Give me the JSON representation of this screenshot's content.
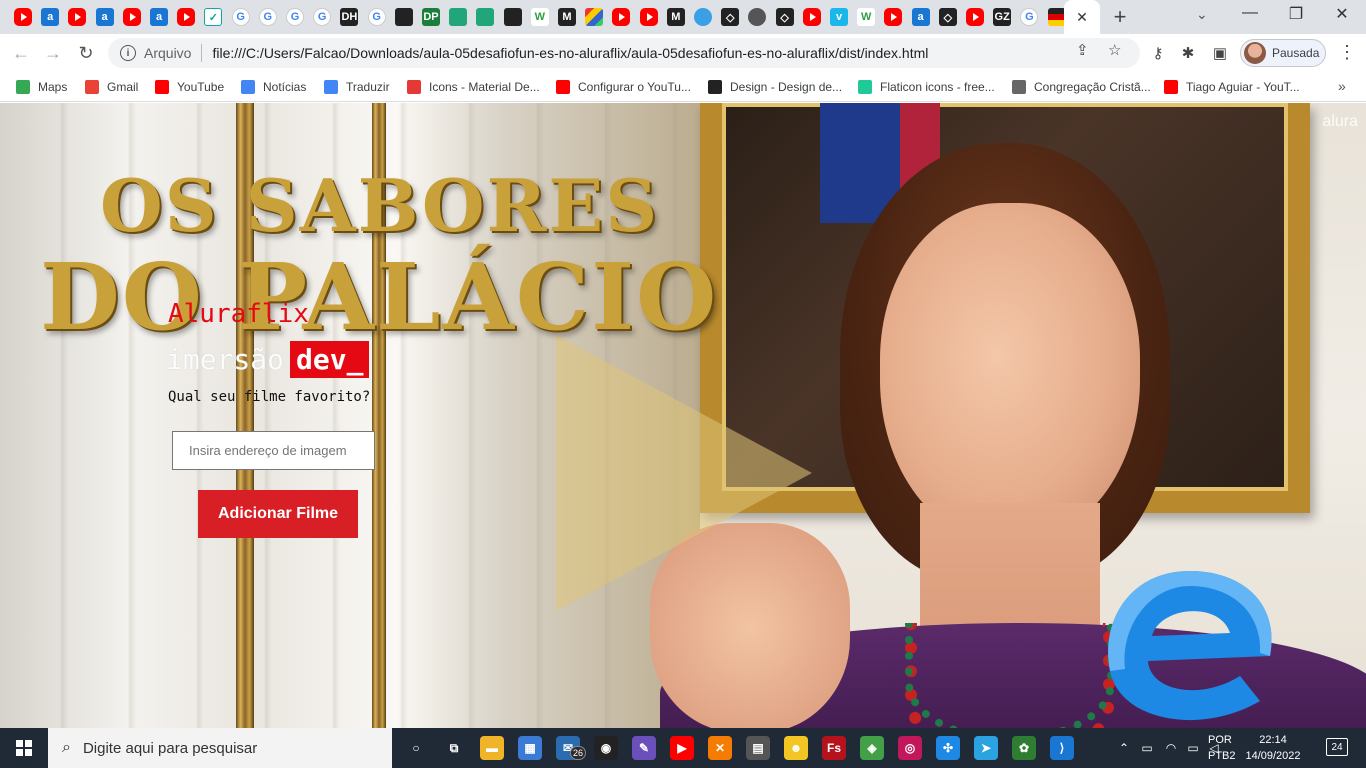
{
  "browser": {
    "tabs": {
      "active_tab_close": "✕",
      "new_tab": "+",
      "tab_search": "⌄",
      "minimize": "—",
      "restore": "❐",
      "close": "✕",
      "favicon_names": [
        "youtube-icon",
        "alura-icon",
        "youtube-icon",
        "alura-icon",
        "youtube-icon",
        "alura-icon",
        "youtube-icon",
        "check-icon",
        "google-icon",
        "google-icon",
        "google-icon",
        "google-icon",
        "dh-icon",
        "google-icon",
        "github-icon",
        "dp-icon",
        "green-app-icon",
        "teal-app-icon",
        "dark-app-icon",
        "w-icon",
        "m-icon",
        "multicolor-icon",
        "youtube-icon",
        "youtube-icon",
        "m-icon",
        "blue-circle-icon",
        "codepen-icon",
        "gray-circle-icon",
        "codepen-icon",
        "youtube-icon",
        "vimeo-icon",
        "w-icon",
        "youtube-icon",
        "alura-icon",
        "codepen-icon",
        "youtube-icon",
        "gzh-icon",
        "google-icon",
        "germany-flag-icon"
      ]
    },
    "toolbar": {
      "back": "←",
      "forward": "→",
      "reload": "↻",
      "info": "i",
      "scheme_label": "Arquivo",
      "url": "file:///C:/Users/Falcao/Downloads/aula-05desafiofun-es-no-aluraflix/aula-05desafiofun-es-no-aluraflix/dist/index.html",
      "share": "⇪",
      "bookmark_star": "☆",
      "key": "⚷",
      "extensions": "✱",
      "sidepanel": "▣",
      "profile_label": "Pausada",
      "menu": "⋮"
    },
    "bookmarks": [
      {
        "label": "Maps",
        "icon": "maps-icon",
        "color": "#34a853"
      },
      {
        "label": "Gmail",
        "icon": "gmail-icon",
        "color": "#ea4335"
      },
      {
        "label": "YouTube",
        "icon": "youtube-icon",
        "color": "#ff0000"
      },
      {
        "label": "Notícias",
        "icon": "news-icon",
        "color": "#4285f4"
      },
      {
        "label": "Traduzir",
        "icon": "translate-icon",
        "color": "#4285f4"
      },
      {
        "label": "Icons - Material De...",
        "icon": "material-icon",
        "color": "#e53935"
      },
      {
        "label": "Configurar o YouTu...",
        "icon": "youtube-icon",
        "color": "#ff0000"
      },
      {
        "label": "Design - Design de...",
        "icon": "design-icon",
        "color": "#222222"
      },
      {
        "label": "Flaticon icons - free...",
        "icon": "flaticon-icon",
        "color": "#20c997"
      },
      {
        "label": "Congregação Cristã...",
        "icon": "globe-icon",
        "color": "#666666"
      },
      {
        "label": "Tiago Aguiar - YouT...",
        "icon": "youtube-icon",
        "color": "#ff0000"
      }
    ],
    "bookmarks_overflow": "»"
  },
  "page": {
    "poster_title_line1": "OS SABORES",
    "poster_title_line2": "DO PALÁCIO",
    "alura_watermark": "alura",
    "brand": "Aluraflix",
    "imersao_word": "imersão",
    "dev_badge": "dev_",
    "question": "Qual seu filme favorito?",
    "image_input": {
      "value": "",
      "placeholder": "Insira endereço de imagem"
    },
    "add_button": "Adicionar Filme",
    "colors": {
      "brand_red": "#e50914",
      "button_red": "#d91f26"
    }
  },
  "taskbar": {
    "search_placeholder": "Digite aqui para pesquisar",
    "apps": [
      {
        "name": "cortana-icon",
        "glyph": "○"
      },
      {
        "name": "task-view-icon",
        "glyph": "⧉"
      },
      {
        "name": "file-explorer-icon",
        "glyph": "▬"
      },
      {
        "name": "store-icon",
        "glyph": "▦"
      },
      {
        "name": "mail-icon",
        "glyph": "✉",
        "badge": "26"
      },
      {
        "name": "github-desktop-icon",
        "glyph": "◉"
      },
      {
        "name": "paint-icon",
        "glyph": "✎"
      },
      {
        "name": "youtube-icon",
        "glyph": "▶"
      },
      {
        "name": "xampp-icon",
        "glyph": "✕"
      },
      {
        "name": "calculator-icon",
        "glyph": "▤"
      },
      {
        "name": "app-yellow-icon",
        "glyph": "☻"
      },
      {
        "name": "fireworks-icon",
        "glyph": "Fs"
      },
      {
        "name": "cube-icon",
        "glyph": "◈"
      },
      {
        "name": "screen-recorder-icon",
        "glyph": "◎"
      },
      {
        "name": "network-app-icon",
        "glyph": "✣"
      },
      {
        "name": "telegram-icon",
        "glyph": "➤"
      },
      {
        "name": "evernote-icon",
        "glyph": "✿"
      },
      {
        "name": "vscode-icon",
        "glyph": "⟩"
      }
    ],
    "tray": {
      "lang_line1": "POR",
      "lang_line2": "PTB2",
      "time": "22:14",
      "date": "14/09/2022",
      "notifications": "24"
    }
  }
}
